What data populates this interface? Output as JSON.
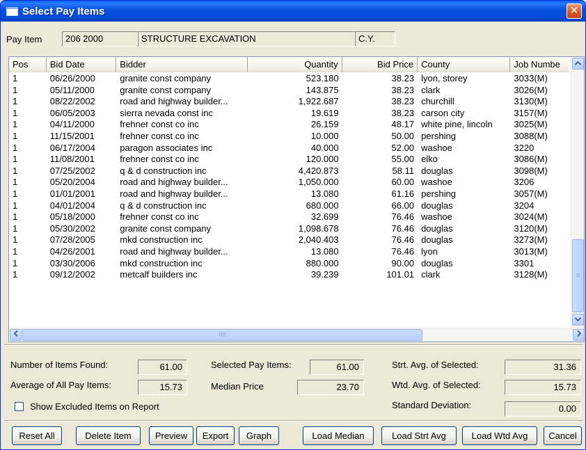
{
  "window": {
    "title": "Select Pay Items",
    "close_label": "✕"
  },
  "pay_item": {
    "label": "Pay Item",
    "code": "206 2000",
    "description": "STRUCTURE EXCAVATION",
    "unit": "C.Y."
  },
  "grid": {
    "columns": [
      "Pos",
      "Bid Date",
      "Bidder",
      "Quantity",
      "Bid Price",
      "County",
      "Job Numbe"
    ],
    "rows": [
      [
        "1",
        "06/26/2000",
        "granite const company",
        "523.180",
        "38.23",
        "lyon, storey",
        "3033(M)"
      ],
      [
        "1",
        "05/11/2000",
        "granite const company",
        "143.875",
        "38.23",
        "clark",
        "3026(M)"
      ],
      [
        "1",
        "08/22/2002",
        "road and highway builder...",
        "1,922.687",
        "38.23",
        "churchill",
        "3130(M)"
      ],
      [
        "1",
        "06/05/2003",
        "sierra nevada const inc",
        "19.619",
        "38.23",
        "carson city",
        "3157(M)"
      ],
      [
        "1",
        "04/11/2000",
        "frehner const co inc",
        "26.159",
        "48.17",
        "white pine, lincoln",
        "3025(M)"
      ],
      [
        "1",
        "11/15/2001",
        "frehner const co inc",
        "10.000",
        "50.00",
        "pershing",
        "3088(M)"
      ],
      [
        "1",
        "06/17/2004",
        "paragon associates inc",
        "40.000",
        "52.00",
        "washoe",
        "3220"
      ],
      [
        "1",
        "11/08/2001",
        "frehner const co inc",
        "120.000",
        "55.00",
        "elko",
        "3086(M)"
      ],
      [
        "1",
        "07/25/2002",
        "q & d construction inc",
        "4,420.873",
        "58.11",
        "douglas",
        "3098(M)"
      ],
      [
        "1",
        "05/20/2004",
        "road and highway builder...",
        "1,050.000",
        "60.00",
        "washoe",
        "3206"
      ],
      [
        "1",
        "01/01/2001",
        "road and highway builder...",
        "13.080",
        "61.16",
        "pershing",
        "3057(M)"
      ],
      [
        "1",
        "04/01/2004",
        "q & d construction inc",
        "680.000",
        "66.00",
        "douglas",
        "3204"
      ],
      [
        "1",
        "05/18/2000",
        "frehner const co inc",
        "32.699",
        "76.46",
        "washoe",
        "3024(M)"
      ],
      [
        "1",
        "05/30/2002",
        "granite const company",
        "1,098.678",
        "76.46",
        "douglas",
        "3120(M)"
      ],
      [
        "1",
        "07/28/2005",
        "mkd construction inc",
        "2,040.403",
        "76.46",
        "douglas",
        "3273(M)"
      ],
      [
        "1",
        "04/26/2001",
        "road and highway builder...",
        "13.080",
        "76.46",
        "lyon",
        "3013(M)"
      ],
      [
        "1",
        "03/30/2006",
        "mkd construction inc",
        "880.000",
        "90.00",
        "douglas",
        "3301"
      ],
      [
        "1",
        "09/12/2002",
        "metcalf builders inc",
        "39.239",
        "101.01",
        "clark",
        "3128(M)"
      ]
    ]
  },
  "stats": {
    "items_found_label": "Number of Items Found:",
    "items_found": "61.00",
    "average_label": "Average of All Pay Items:",
    "average": "15.73",
    "selected_label": "Selected Pay Items:",
    "selected": "61.00",
    "median_label": "Median Price",
    "median": "23.70",
    "strt_avg_label": "Strt. Avg. of Selected:",
    "strt_avg": "31.36",
    "wtd_avg_label": "Wtd. Avg. of Selected:",
    "wtd_avg": "15.73",
    "std_dev_label": "Standard Deviation:",
    "std_dev": "0.00",
    "show_excluded_label": "Show Excluded Items on Report",
    "show_excluded_checked": false
  },
  "buttons": {
    "reset_all": "Reset All",
    "delete_item": "Delete Item",
    "preview": "Preview",
    "export": "Export",
    "graph": "Graph",
    "load_median": "Load Median",
    "load_strt_avg": "Load Strt Avg",
    "load_wtd_avg": "Load Wtd Avg",
    "cancel": "Cancel"
  },
  "scroll": {
    "hthumb_grip": "IIII",
    "vthumb_grip": "≡"
  }
}
